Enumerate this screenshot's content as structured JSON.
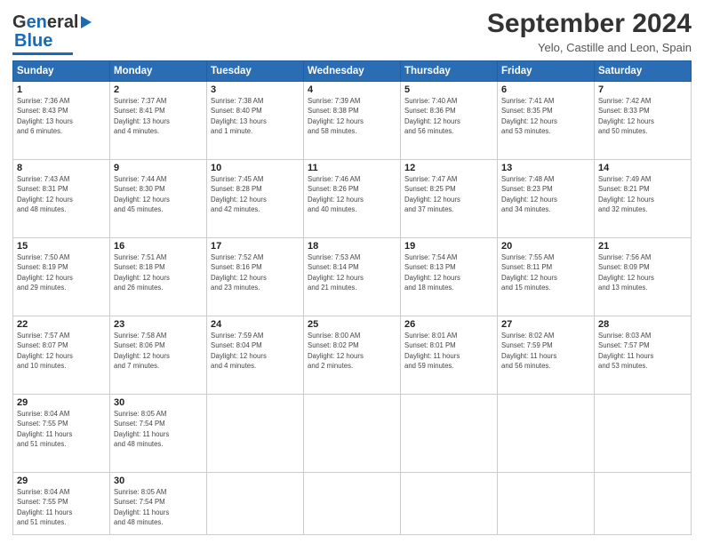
{
  "header": {
    "logo_line1": "General",
    "logo_line2": "Blue",
    "title": "September 2024",
    "subtitle": "Yelo, Castille and Leon, Spain"
  },
  "calendar": {
    "headers": [
      "Sunday",
      "Monday",
      "Tuesday",
      "Wednesday",
      "Thursday",
      "Friday",
      "Saturday"
    ],
    "weeks": [
      [
        null,
        null,
        null,
        null,
        {
          "day": "5",
          "info": "Sunrise: 7:40 AM\nSunset: 8:36 PM\nDaylight: 12 hours\nand 56 minutes."
        },
        {
          "day": "6",
          "info": "Sunrise: 7:41 AM\nSunset: 8:35 PM\nDaylight: 12 hours\nand 53 minutes."
        },
        {
          "day": "7",
          "info": "Sunrise: 7:42 AM\nSunset: 8:33 PM\nDaylight: 12 hours\nand 50 minutes."
        }
      ],
      [
        {
          "day": "8",
          "info": "Sunrise: 7:43 AM\nSunset: 8:31 PM\nDaylight: 12 hours\nand 48 minutes."
        },
        {
          "day": "9",
          "info": "Sunrise: 7:44 AM\nSunset: 8:30 PM\nDaylight: 12 hours\nand 45 minutes."
        },
        {
          "day": "10",
          "info": "Sunrise: 7:45 AM\nSunset: 8:28 PM\nDaylight: 12 hours\nand 42 minutes."
        },
        {
          "day": "11",
          "info": "Sunrise: 7:46 AM\nSunset: 8:26 PM\nDaylight: 12 hours\nand 40 minutes."
        },
        {
          "day": "12",
          "info": "Sunrise: 7:47 AM\nSunset: 8:25 PM\nDaylight: 12 hours\nand 37 minutes."
        },
        {
          "day": "13",
          "info": "Sunrise: 7:48 AM\nSunset: 8:23 PM\nDaylight: 12 hours\nand 34 minutes."
        },
        {
          "day": "14",
          "info": "Sunrise: 7:49 AM\nSunset: 8:21 PM\nDaylight: 12 hours\nand 32 minutes."
        }
      ],
      [
        {
          "day": "15",
          "info": "Sunrise: 7:50 AM\nSunset: 8:19 PM\nDaylight: 12 hours\nand 29 minutes."
        },
        {
          "day": "16",
          "info": "Sunrise: 7:51 AM\nSunset: 8:18 PM\nDaylight: 12 hours\nand 26 minutes."
        },
        {
          "day": "17",
          "info": "Sunrise: 7:52 AM\nSunset: 8:16 PM\nDaylight: 12 hours\nand 23 minutes."
        },
        {
          "day": "18",
          "info": "Sunrise: 7:53 AM\nSunset: 8:14 PM\nDaylight: 12 hours\nand 21 minutes."
        },
        {
          "day": "19",
          "info": "Sunrise: 7:54 AM\nSunset: 8:13 PM\nDaylight: 12 hours\nand 18 minutes."
        },
        {
          "day": "20",
          "info": "Sunrise: 7:55 AM\nSunset: 8:11 PM\nDaylight: 12 hours\nand 15 minutes."
        },
        {
          "day": "21",
          "info": "Sunrise: 7:56 AM\nSunset: 8:09 PM\nDaylight: 12 hours\nand 13 minutes."
        }
      ],
      [
        {
          "day": "22",
          "info": "Sunrise: 7:57 AM\nSunset: 8:07 PM\nDaylight: 12 hours\nand 10 minutes."
        },
        {
          "day": "23",
          "info": "Sunrise: 7:58 AM\nSunset: 8:06 PM\nDaylight: 12 hours\nand 7 minutes."
        },
        {
          "day": "24",
          "info": "Sunrise: 7:59 AM\nSunset: 8:04 PM\nDaylight: 12 hours\nand 4 minutes."
        },
        {
          "day": "25",
          "info": "Sunrise: 8:00 AM\nSunset: 8:02 PM\nDaylight: 12 hours\nand 2 minutes."
        },
        {
          "day": "26",
          "info": "Sunrise: 8:01 AM\nSunset: 8:01 PM\nDaylight: 11 hours\nand 59 minutes."
        },
        {
          "day": "27",
          "info": "Sunrise: 8:02 AM\nSunset: 7:59 PM\nDaylight: 11 hours\nand 56 minutes."
        },
        {
          "day": "28",
          "info": "Sunrise: 8:03 AM\nSunset: 7:57 PM\nDaylight: 11 hours\nand 53 minutes."
        }
      ],
      [
        {
          "day": "29",
          "info": "Sunrise: 8:04 AM\nSunset: 7:55 PM\nDaylight: 11 hours\nand 51 minutes."
        },
        {
          "day": "30",
          "info": "Sunrise: 8:05 AM\nSunset: 7:54 PM\nDaylight: 11 hours\nand 48 minutes."
        },
        null,
        null,
        null,
        null,
        null
      ]
    ],
    "week0": [
      {
        "day": "1",
        "info": "Sunrise: 7:36 AM\nSunset: 8:43 PM\nDaylight: 13 hours\nand 6 minutes."
      },
      {
        "day": "2",
        "info": "Sunrise: 7:37 AM\nSunset: 8:41 PM\nDaylight: 13 hours\nand 4 minutes."
      },
      {
        "day": "3",
        "info": "Sunrise: 7:38 AM\nSunset: 8:40 PM\nDaylight: 13 hours\nand 1 minute."
      },
      {
        "day": "4",
        "info": "Sunrise: 7:39 AM\nSunset: 8:38 PM\nDaylight: 12 hours\nand 58 minutes."
      },
      {
        "day": "5",
        "info": "Sunrise: 7:40 AM\nSunset: 8:36 PM\nDaylight: 12 hours\nand 56 minutes."
      },
      {
        "day": "6",
        "info": "Sunrise: 7:41 AM\nSunset: 8:35 PM\nDaylight: 12 hours\nand 53 minutes."
      },
      {
        "day": "7",
        "info": "Sunrise: 7:42 AM\nSunset: 8:33 PM\nDaylight: 12 hours\nand 50 minutes."
      }
    ]
  }
}
